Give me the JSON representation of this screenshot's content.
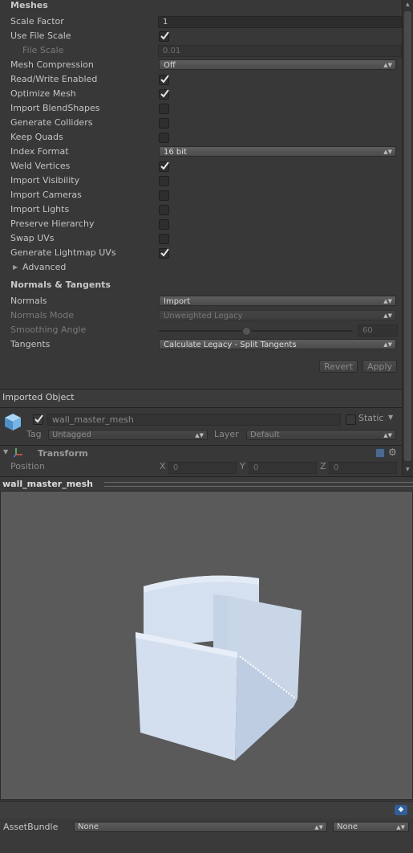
{
  "meshes": {
    "title": "Meshes",
    "scale_factor": {
      "label": "Scale Factor",
      "value": "1"
    },
    "use_file_scale": {
      "label": "Use File Scale",
      "checked": true
    },
    "file_scale": {
      "label": "File Scale",
      "value": "0.01"
    },
    "mesh_compression": {
      "label": "Mesh Compression",
      "value": "Off"
    },
    "read_write": {
      "label": "Read/Write Enabled",
      "checked": true
    },
    "optimize_mesh": {
      "label": "Optimize Mesh",
      "checked": true
    },
    "import_blendshapes": {
      "label": "Import BlendShapes",
      "checked": false
    },
    "generate_colliders": {
      "label": "Generate Colliders",
      "checked": false
    },
    "keep_quads": {
      "label": "Keep Quads",
      "checked": false
    },
    "index_format": {
      "label": "Index Format",
      "value": "16 bit"
    },
    "weld_vertices": {
      "label": "Weld Vertices",
      "checked": true
    },
    "import_visibility": {
      "label": "Import Visibility",
      "checked": false
    },
    "import_cameras": {
      "label": "Import Cameras",
      "checked": false
    },
    "import_lights": {
      "label": "Import Lights",
      "checked": false
    },
    "preserve_hierarchy": {
      "label": "Preserve Hierarchy",
      "checked": false
    },
    "swap_uvs": {
      "label": "Swap UVs",
      "checked": false
    },
    "generate_lightmap_uvs": {
      "label": "Generate Lightmap UVs",
      "checked": true
    },
    "advanced": {
      "label": "Advanced"
    }
  },
  "normals": {
    "title": "Normals & Tangents",
    "normals": {
      "label": "Normals",
      "value": "Import"
    },
    "normals_mode": {
      "label": "Normals Mode",
      "value": "Unweighted Legacy"
    },
    "smoothing_angle": {
      "label": "Smoothing Angle",
      "value": "60",
      "fraction": 0.45
    },
    "tangents": {
      "label": "Tangents",
      "value": "Calculate Legacy - Split Tangents"
    }
  },
  "actions": {
    "revert": "Revert",
    "apply": "Apply"
  },
  "imported_object": {
    "header": "Imported Object",
    "name": "wall_master_mesh",
    "active": true,
    "static_label": "Static",
    "static_checked": false,
    "tag_label": "Tag",
    "tag_value": "Untagged",
    "layer_label": "Layer",
    "layer_value": "Default"
  },
  "transform": {
    "title": "Transform",
    "position_label": "Position",
    "x_label": "X",
    "x": "0",
    "y_label": "Y",
    "y": "0",
    "z_label": "Z",
    "z": "0"
  },
  "preview": {
    "title": "wall_master_mesh",
    "background": "#5a5a5a",
    "mesh_color": "#cfdcee"
  },
  "assetbundle": {
    "label": "AssetBundle",
    "bundle": "None",
    "variant": "None"
  }
}
